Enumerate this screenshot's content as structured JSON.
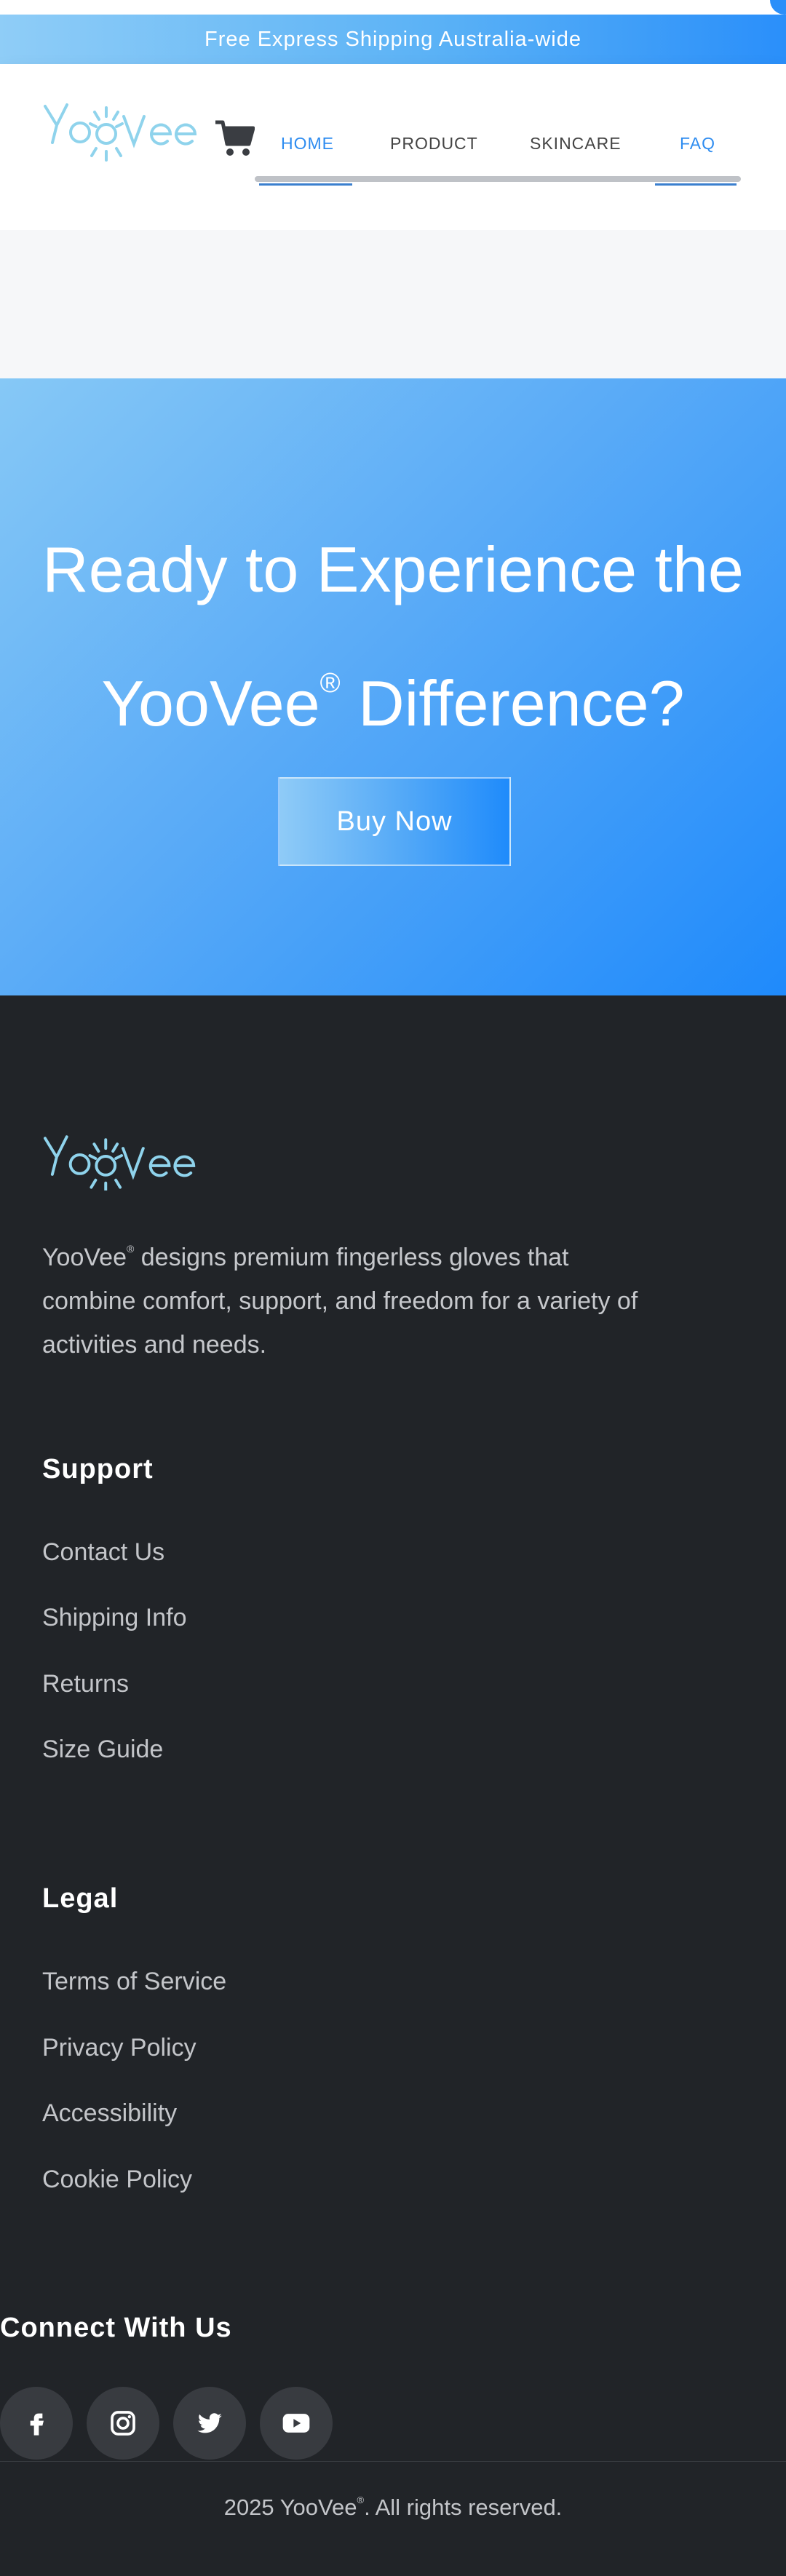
{
  "announcement": {
    "text": "Free Express Shipping Australia-wide"
  },
  "brand": {
    "logo_text": "YooVee",
    "accent": "#2e8cf0",
    "logo_color": "#8fd3ec"
  },
  "nav": {
    "items": [
      {
        "label": "HOME",
        "active": true
      },
      {
        "label": "PRODUCT",
        "active": false
      },
      {
        "label": "SKINCARE",
        "active": false
      },
      {
        "label": "FAQ",
        "active": true
      }
    ],
    "cart_icon": "cart-icon"
  },
  "cta": {
    "line1": "Ready to Experience the",
    "line2_brand": "YooVee",
    "registered": "®",
    "line2_rest": " Difference?",
    "button_label": "Buy Now",
    "gradient": [
      "#86c8f6",
      "#1f8afb"
    ]
  },
  "footer": {
    "description_brand": "YooVee",
    "registered": "®",
    "description_rest": " designs premium fingerless gloves that combine comfort, support, and freedom for a variety of activities and needs.",
    "support": {
      "title": "Support",
      "links": [
        "Contact Us",
        "Shipping Info",
        "Returns",
        "Size Guide"
      ]
    },
    "legal": {
      "title": "Legal",
      "links": [
        "Terms of Service",
        "Privacy Policy",
        "Accessibility",
        "Cookie Policy"
      ]
    },
    "connect": {
      "title": "Connect With Us",
      "icons": [
        "facebook-icon",
        "instagram-icon",
        "twitter-icon",
        "youtube-icon"
      ]
    },
    "copyright_prefix": "2025 YooVee",
    "copyright_suffix": ". All rights reserved.",
    "background": "#212428"
  }
}
